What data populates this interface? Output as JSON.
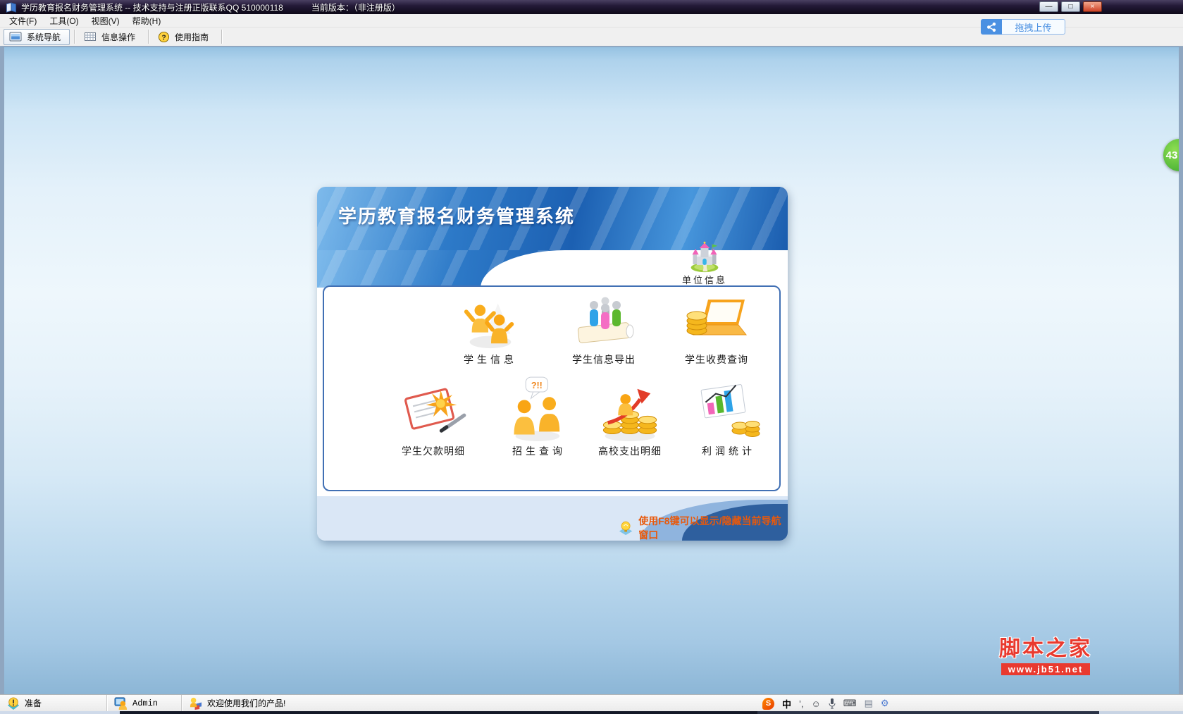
{
  "titlebar": {
    "title": "学历教育报名财务管理系统 -- 技术支持与注册正版联系QQ 510000118",
    "version": "当前版本：（非注册版）",
    "minimize": "—",
    "maximize": "□",
    "close": "×"
  },
  "menubar": {
    "items": [
      {
        "label": "文件(F)"
      },
      {
        "label": "工具(O)"
      },
      {
        "label": "视图(V)"
      },
      {
        "label": "帮助(H)"
      }
    ]
  },
  "toolbar": {
    "nav": "系统导航",
    "info": "信息操作",
    "guide": "使用指南",
    "guide_glyph": "?",
    "upload": "拖拽上传"
  },
  "floating_badge": {
    "value": "43"
  },
  "panel": {
    "title": "学历教育报名财务管理系统",
    "unit": {
      "label": "单位信息"
    },
    "row1": [
      {
        "label": "学生信息"
      },
      {
        "label": "学生信息导出"
      },
      {
        "label": "学生收费查询"
      }
    ],
    "row2": [
      {
        "label": "学生欠款明细"
      },
      {
        "label": "招生查询",
        "bubble": "?!!"
      },
      {
        "label": "高校支出明细"
      },
      {
        "label": "利润统计"
      }
    ],
    "tip": {
      "prefix": "使用",
      "key": "F8",
      "suffix": "键可以显示/隐藏当前导航窗口"
    }
  },
  "statusbar": {
    "ready": "准备",
    "user": "Admin",
    "welcome": "欢迎使用我们的产品!"
  },
  "tray": {
    "sogou": "S",
    "lang": "中",
    "punct": "’,",
    "smiley": "☺",
    "keyboard": "⌨",
    "clipboard": "▤",
    "tools": "⚙"
  },
  "watermark": {
    "title": "脚本之家",
    "url": "www.jb51.net"
  },
  "colors": {
    "header_blue": "#1f6cb8",
    "tip_orange": "#e8590c",
    "upload_blue": "#4a90e2",
    "badge_green": "#3fae3a",
    "watermark_red": "#e93a2f"
  }
}
